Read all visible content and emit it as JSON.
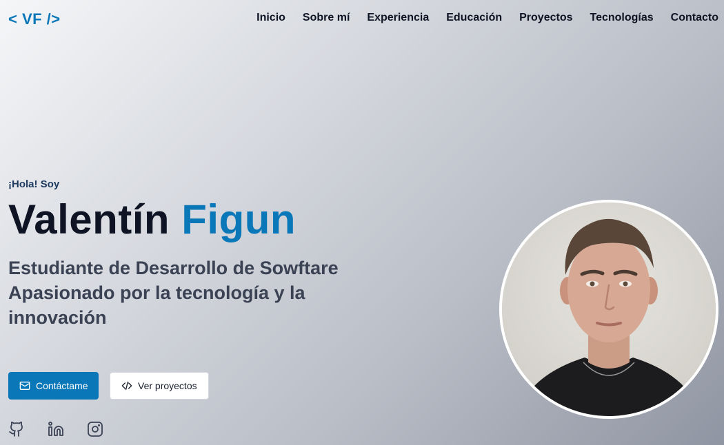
{
  "logo": "< VF />",
  "nav": {
    "items": [
      "Inicio",
      "Sobre mí",
      "Experiencia",
      "Educación",
      "Proyectos",
      "Tecnologías",
      "Contacto"
    ]
  },
  "hero": {
    "greeting": "¡Hola! Soy",
    "first_name": "Valentín",
    "last_name": "Figun",
    "subtitle_line1": "Estudiante de Desarrollo de Sowftare",
    "subtitle_line2": "Apasionado por la tecnología y la innovación",
    "contact_button": "Contáctame",
    "projects_button": "Ver proyectos"
  },
  "social": [
    "github-icon",
    "linkedin-icon",
    "instagram-icon"
  ],
  "colors": {
    "accent": "#0a77b8",
    "text_dark": "#0f1424",
    "subtitle": "#3a4254"
  }
}
